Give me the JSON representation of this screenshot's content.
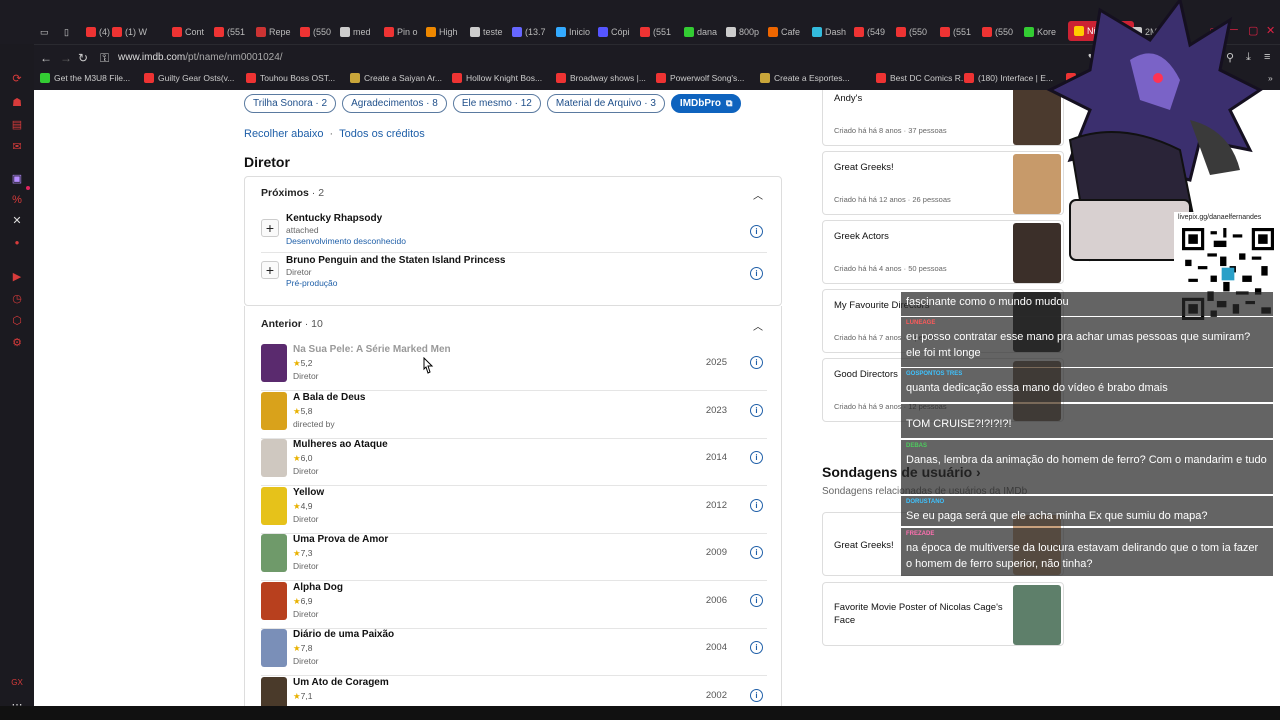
{
  "tabs": [
    {
      "label": "(4) D"
    },
    {
      "label": "(1) W"
    },
    {
      "label": "Cont"
    },
    {
      "label": "(551"
    },
    {
      "label": "Repe"
    },
    {
      "label": "(550"
    },
    {
      "label": "med"
    },
    {
      "label": "Pin o"
    },
    {
      "label": "High"
    },
    {
      "label": "teste"
    },
    {
      "label": "(13.7"
    },
    {
      "label": "Inicio"
    },
    {
      "label": "Cópi"
    },
    {
      "label": "(551"
    },
    {
      "label": "dana"
    },
    {
      "label": "800p"
    },
    {
      "label": "Cafe"
    },
    {
      "label": "Dash"
    },
    {
      "label": "(549"
    },
    {
      "label": "(550"
    },
    {
      "label": "(551"
    },
    {
      "label": "(550"
    },
    {
      "label": "Kore"
    },
    {
      "label": "Nick Cass"
    },
    {
      "label": "2M"
    }
  ],
  "address": {
    "prefix": "www.imdb.com",
    "path": "/pt/name/nm0001024/"
  },
  "bookmarks": [
    "Get the M3U8 File...",
    "Guilty Gear Osts(v...",
    "Touhou Boss OST...",
    "Create a Saiyan Ar...",
    "Hollow Knight Bos...",
    "Broadway shows |...",
    "Powerwolf Song's...",
    "Create a Esportes...",
    "Best DC Comics R...",
    "(180) Interface | E...",
    "(647)"
  ],
  "chips": [
    "Trilha Sonora · 2",
    "Agradecimentos · 8",
    "Ele mesmo · 12",
    "Material de Arquivo · 3",
    "IMDbPro"
  ],
  "links": {
    "collapse": "Recolher abaixo",
    "sep": "·",
    "all": "Todos os créditos"
  },
  "section_title": "Diretor",
  "upcoming": {
    "label": "Próximos",
    "count": "· 2",
    "items": [
      {
        "title": "Kentucky Rhapsody",
        "sub": "attached",
        "status": "Desenvolvimento desconhecido"
      },
      {
        "title": "Bruno Penguin and the Staten Island Princess",
        "sub": "Diretor",
        "status": "Pré-produção"
      }
    ]
  },
  "previous": {
    "label": "Anterior",
    "count": "· 10",
    "items": [
      {
        "title": "Na Sua Pele: A Série Marked Men",
        "rating": "5,2",
        "role": "Diretor",
        "year": "2025",
        "color": "#5a2a6e"
      },
      {
        "title": "A Bala de Deus",
        "rating": "5,8",
        "role": "directed by",
        "year": "2023",
        "color": "#d9a21b"
      },
      {
        "title": "Mulheres ao Ataque",
        "rating": "6,0",
        "role": "Diretor",
        "year": "2014",
        "color": "#cfc8c0"
      },
      {
        "title": "Yellow",
        "rating": "4,9",
        "role": "Diretor",
        "year": "2012",
        "color": "#e6c21a"
      },
      {
        "title": "Uma Prova de Amor",
        "rating": "7,3",
        "role": "Diretor",
        "year": "2009",
        "color": "#6f9a6a"
      },
      {
        "title": "Alpha Dog",
        "rating": "6,9",
        "role": "Diretor",
        "year": "2006",
        "color": "#b8401e"
      },
      {
        "title": "Diário de uma Paixão",
        "rating": "7,8",
        "role": "Diretor",
        "year": "2004",
        "color": "#7a8fb8"
      },
      {
        "title": "Um Ato de Coragem",
        "rating": "7,1",
        "role": "Diretor",
        "year": "2002",
        "color": "#4a3a2a"
      }
    ]
  },
  "lists": [
    {
      "title": "Andy's",
      "meta": "Criado há há 8 anos · 37 pessoas",
      "color": "#4b3a2e"
    },
    {
      "title": "Great Greeks!",
      "meta": "Criado há há 12 anos · 26 pessoas",
      "color": "#c79a6a"
    },
    {
      "title": "Greek Actors",
      "meta": "Criado há há 4 anos · 50 pessoas",
      "color": "#3b2f29"
    },
    {
      "title": "My Favourite Directors",
      "meta": "Criado há há 7 anos · 9 pessoas",
      "color": "#2a2a2a"
    },
    {
      "title": "Good Directors",
      "meta": "Criado há há 9 anos · 12 pessoas",
      "color": "#7a6a5a"
    }
  ],
  "polls": {
    "title": "Sondagens de usuário",
    "subtitle": "Sondagens relacionadas de usuários da IMDb",
    "items": [
      {
        "title": "Great Greeks!",
        "color": "#c9a27e"
      },
      {
        "title": "Favorite Movie Poster of Nicolas Cage's Face",
        "color": "#5e7f6a"
      }
    ]
  },
  "overlay": {
    "qr_label": "livepix.gg/danaelfernandes",
    "chat": [
      {
        "user": "",
        "user_color": "#ffb020",
        "text": "fascinante como o mundo mudou"
      },
      {
        "user": "LUNEAGE",
        "user_color": "#ff5a5a",
        "text": "eu posso contratar esse mano pra achar umas pessoas que sumiram? ele foi mt longe"
      },
      {
        "user": "GOSPONTOS TRES",
        "user_color": "#3ec3ff",
        "text": "quanta dedicação essa mano do vídeo é brabo dmais"
      },
      {
        "user": "",
        "user_color": "#ffb020",
        "text": "TOM CRUISE?!?!?!?!"
      },
      {
        "user": "DEBAS",
        "user_color": "#4ecb5e",
        "text": "Danas, lembra da animação do homem de ferro? Com o mandarim e tudo"
      },
      {
        "user": "DORUSTANO",
        "user_color": "#3ec3ff",
        "text": "Se eu paga será que ele acha minha Ex que sumiu do mapa?"
      },
      {
        "user": "FREZADE",
        "user_color": "#ff6fb0",
        "text": "na época de multiverse da loucura estavam delirando que o tom ia fazer o homem de ferro superior, não tinha?"
      }
    ]
  },
  "colors": {
    "accent": "#0e63be",
    "link": "#1f5fa8",
    "star": "#e8b100",
    "opera": "#d83b3b"
  }
}
